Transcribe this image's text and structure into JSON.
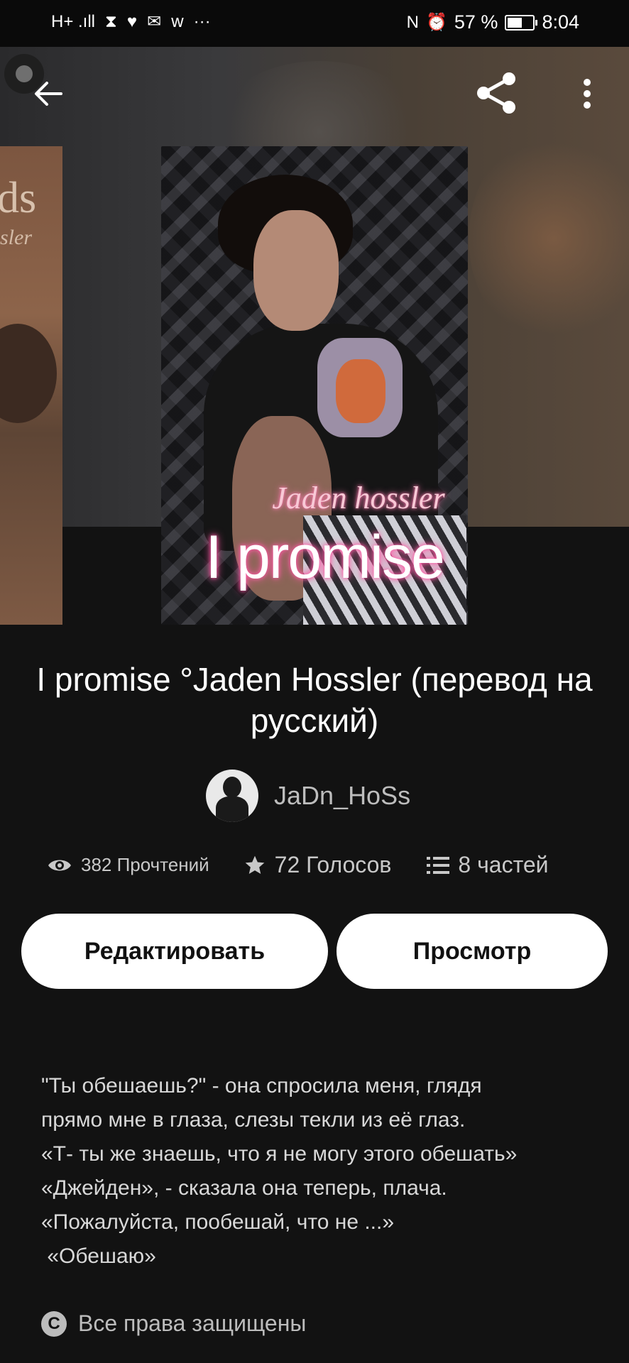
{
  "status_bar": {
    "signal": "H+ .ıll",
    "hourglass_icon": "⧗",
    "heart_icon": "♥",
    "mail_icon": "✉",
    "w_icon": "w",
    "more_dots": "···",
    "nfc": "N",
    "alarm_icon": "⏰",
    "battery_percent": "57 %",
    "battery_level": 0.57,
    "time": "8:04"
  },
  "toolbar": {
    "back_icon": "arrow-left",
    "share_icon": "share",
    "more_icon": "more-vertical"
  },
  "side_cover": {
    "text1": "ds",
    "text2": "sler"
  },
  "cover": {
    "subtitle": "Jaden hossler",
    "title": "I promise"
  },
  "book": {
    "title": "I promise °Jaden Hossler (перевод на русский)",
    "author": "JaDn_HoSs"
  },
  "stats": {
    "reads": "382 Прочтений",
    "votes": "72 Голосов",
    "parts": "8 частей"
  },
  "buttons": {
    "edit": "Редактировать",
    "view": "Просмотр"
  },
  "description": [
    "\"Ты обешаешь?\" - она спросила меня, глядя",
    "прямо мне в глаза, слезы текли из её глаз.",
    "«Т- ты же знаешь, что я не могу этого обешать»",
    "«Джейден», - сказала она теперь, плача.",
    "«Пожалуйста, пообешай, что не ...»",
    " «Обешаю»"
  ],
  "copyright": {
    "icon": "C",
    "label": "Все права защищены"
  },
  "colors": {
    "background": "#121212",
    "button_bg": "#ffffff",
    "neon_pink": "#ff5aa5"
  }
}
